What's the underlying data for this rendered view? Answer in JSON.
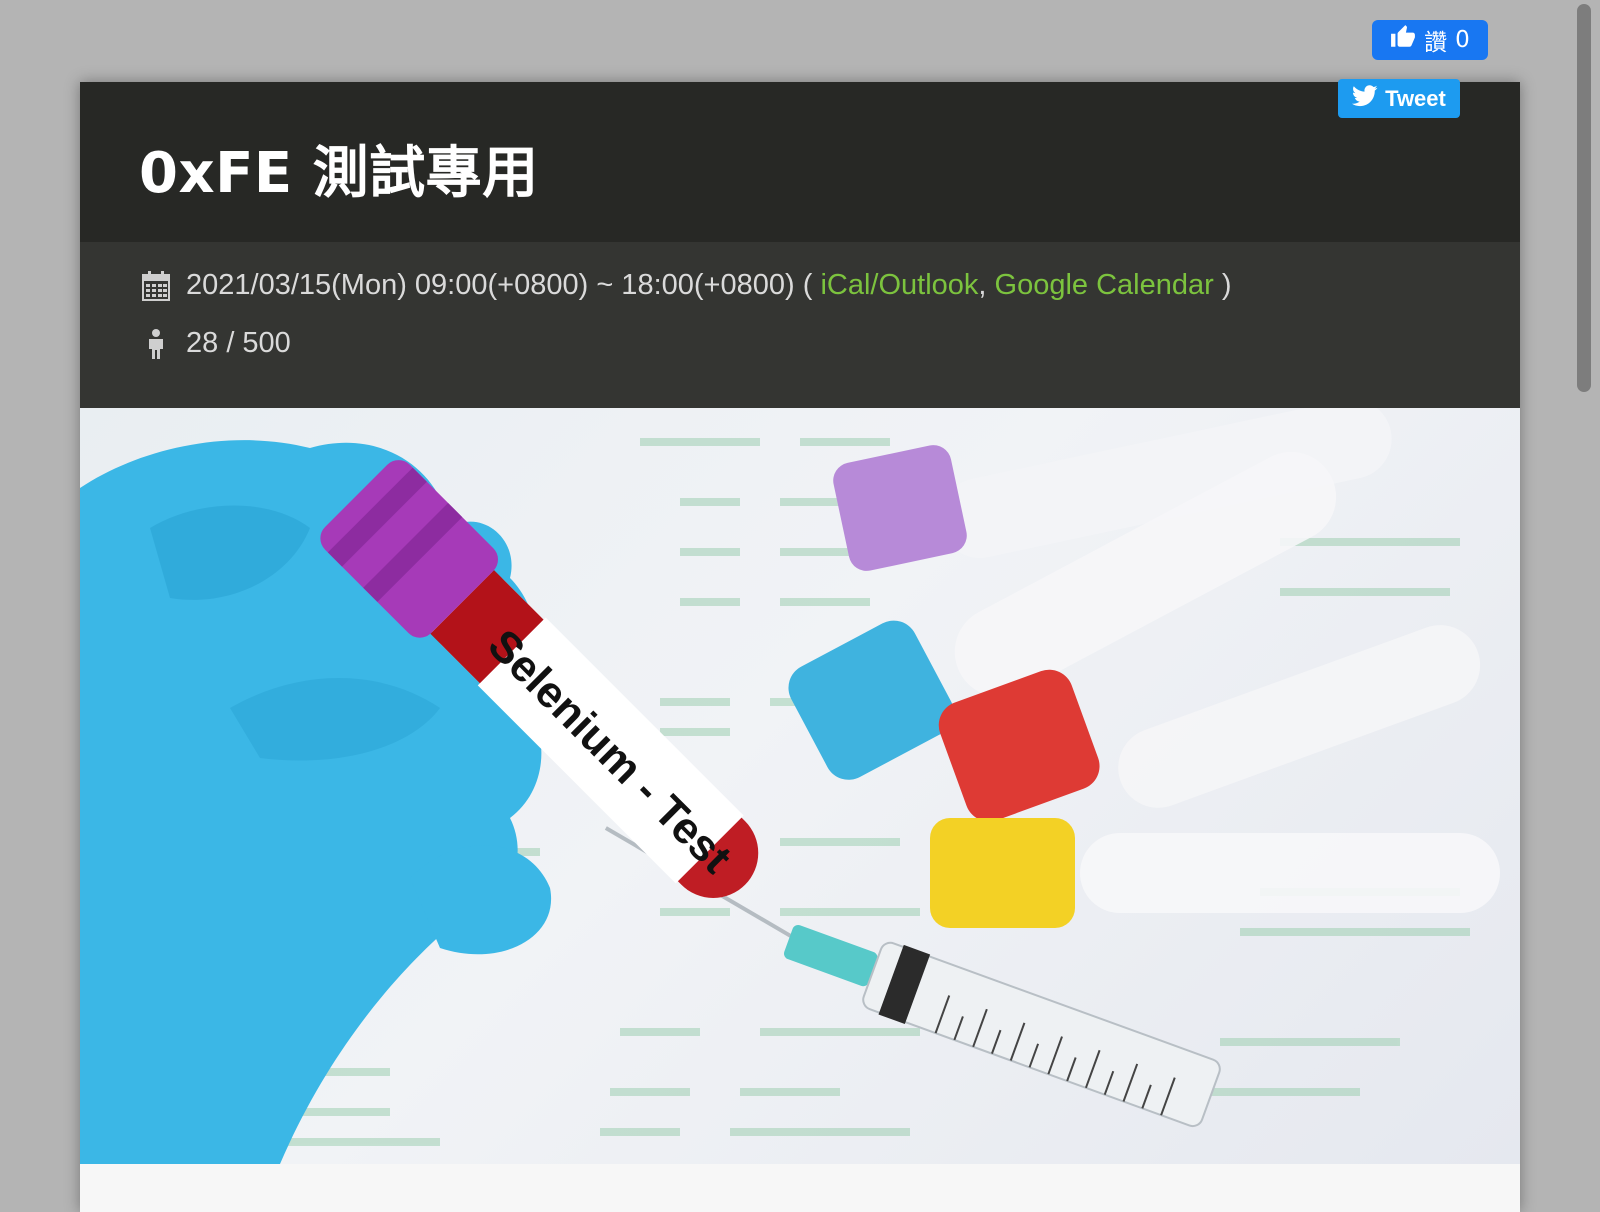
{
  "social": {
    "like_label": "讚",
    "like_count": "0",
    "tweet_label": "Tweet"
  },
  "event": {
    "title": "0xFE 測試專用",
    "datetime": "2021/03/15(Mon) 09:00(+0800) ~ 18:00(+0800) (",
    "ical_link": "iCal/Outlook",
    "separator": ",",
    "gcal_link": "Google Calendar",
    "closing": ")",
    "attendance": "28 / 500"
  },
  "hero": {
    "tube_label": "Selenium - Test"
  },
  "colors": {
    "title_bar": "#272825",
    "info_bar": "#343532",
    "link": "#7cc33e",
    "facebook": "#1877f2",
    "twitter": "#1d9bf0"
  },
  "icons": {
    "calendar": "calendar-icon",
    "person": "person-icon",
    "like": "thumbs-up-icon",
    "twitter": "twitter-bird-icon"
  }
}
